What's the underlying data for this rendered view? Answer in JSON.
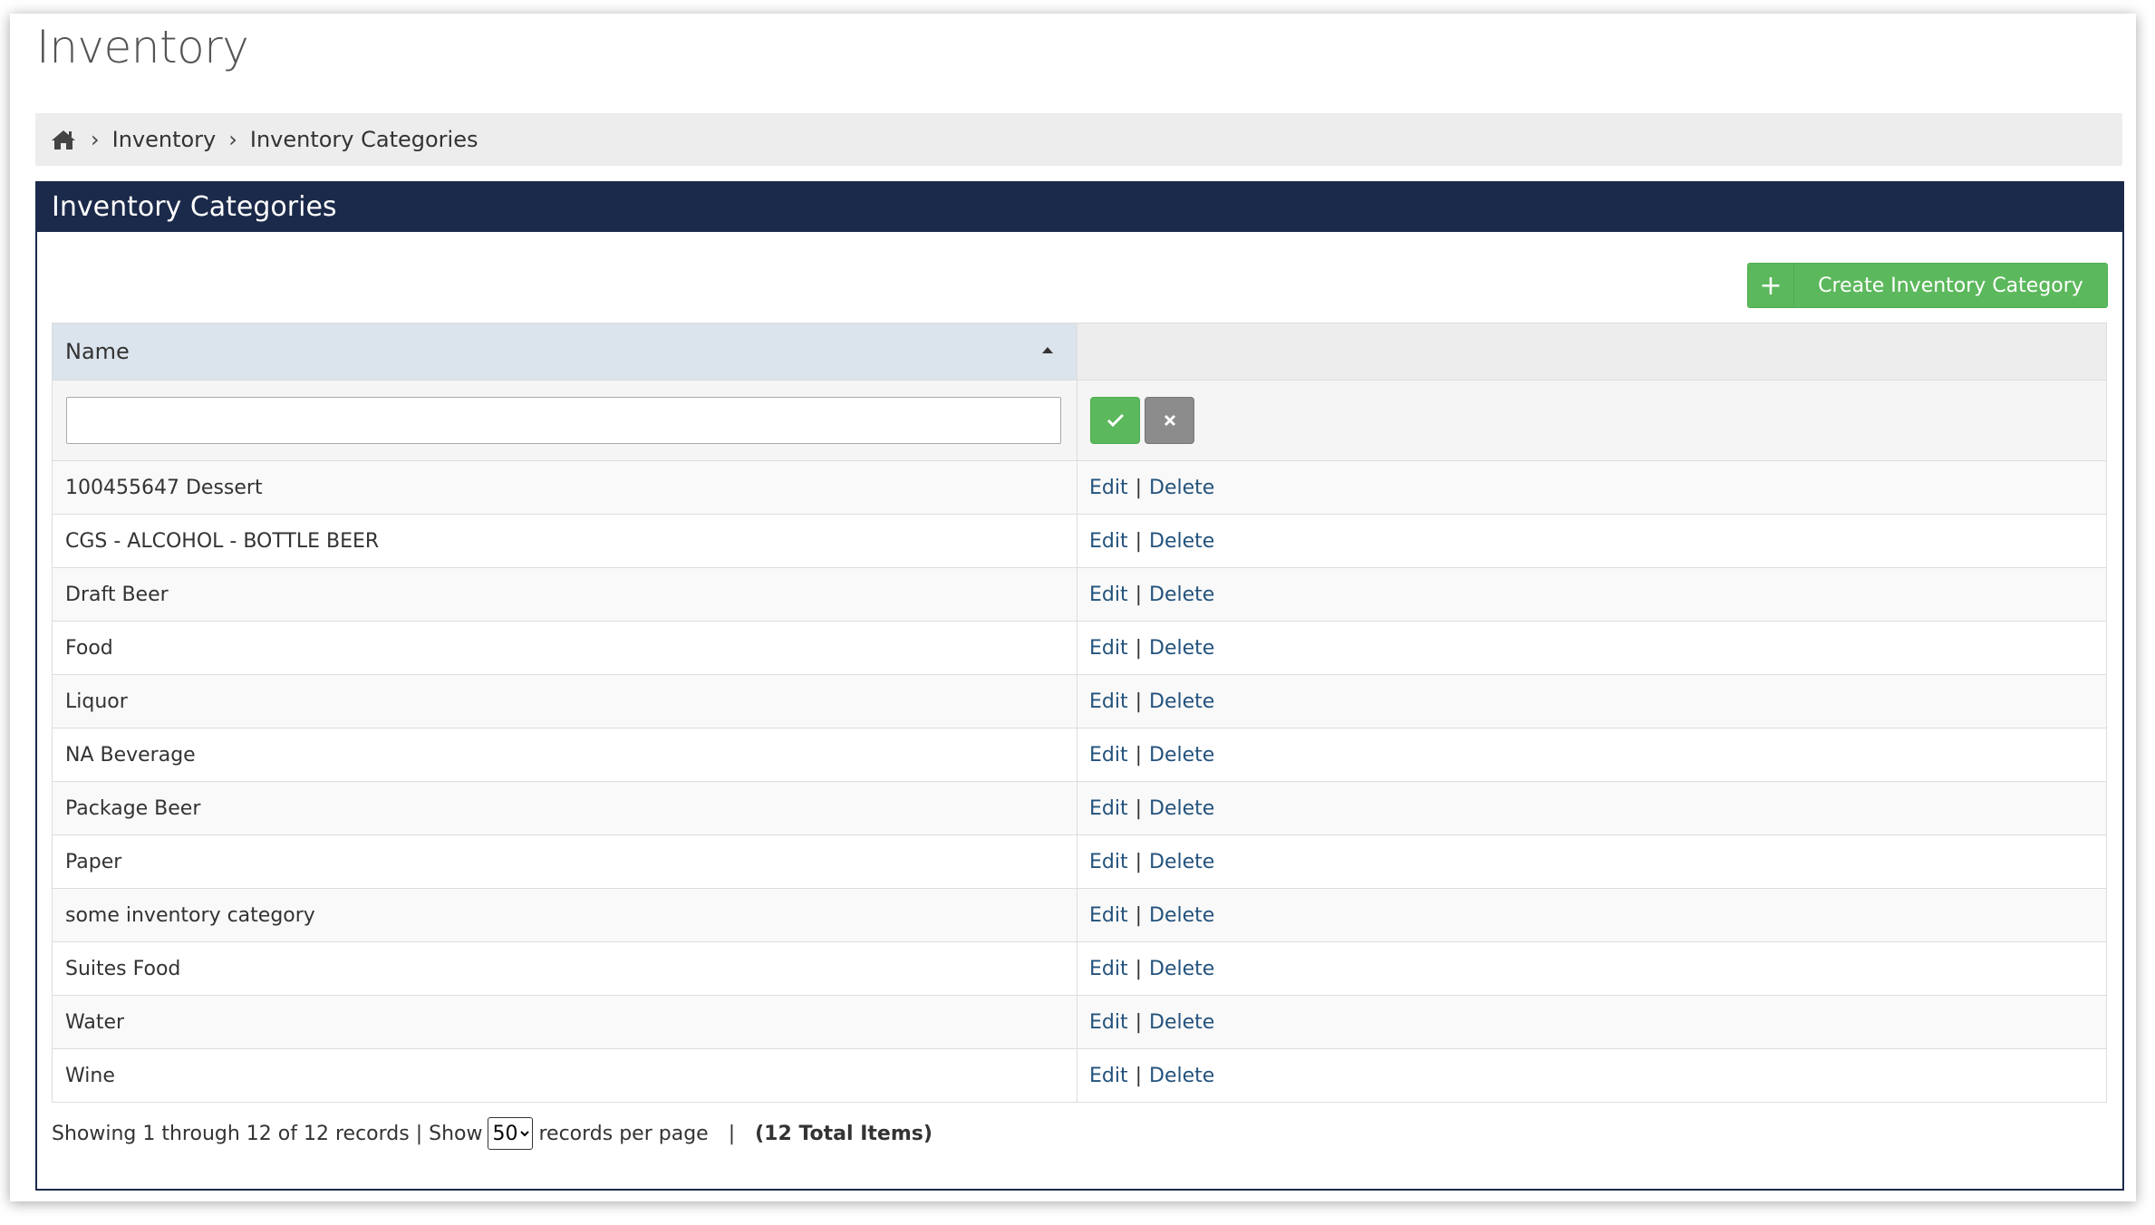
{
  "page": {
    "title": "Inventory"
  },
  "breadcrumb": {
    "home_icon": "home-icon",
    "items": [
      "Inventory",
      "Inventory Categories"
    ],
    "separator": "›"
  },
  "panel": {
    "title": "Inventory Categories"
  },
  "toolbar": {
    "create_label": "Create Inventory Category",
    "create_icon": "+"
  },
  "table": {
    "columns": [
      "Name",
      ""
    ],
    "filter": {
      "value": "",
      "placeholder": ""
    },
    "rows": [
      {
        "name": "100455647 Dessert"
      },
      {
        "name": "CGS - ALCOHOL - BOTTLE BEER"
      },
      {
        "name": "Draft Beer"
      },
      {
        "name": "Food"
      },
      {
        "name": "Liquor"
      },
      {
        "name": "NA Beverage"
      },
      {
        "name": "Package Beer"
      },
      {
        "name": "Paper"
      },
      {
        "name": "some inventory category"
      },
      {
        "name": "Suites Food"
      },
      {
        "name": "Water"
      },
      {
        "name": "Wine"
      }
    ],
    "actions": {
      "edit": "Edit",
      "delete": "Delete",
      "separator": "|"
    }
  },
  "footer": {
    "showing": "Showing 1 through 12 of 12 records | Show",
    "per_page_value": "50",
    "per_page_label": "records per page",
    "separator": "|",
    "total": "(12 Total Items)"
  },
  "colors": {
    "header_bg": "#1b2a4a",
    "success": "#5cb85c",
    "link": "#23527c",
    "muted_btn": "#8c8c8c"
  }
}
